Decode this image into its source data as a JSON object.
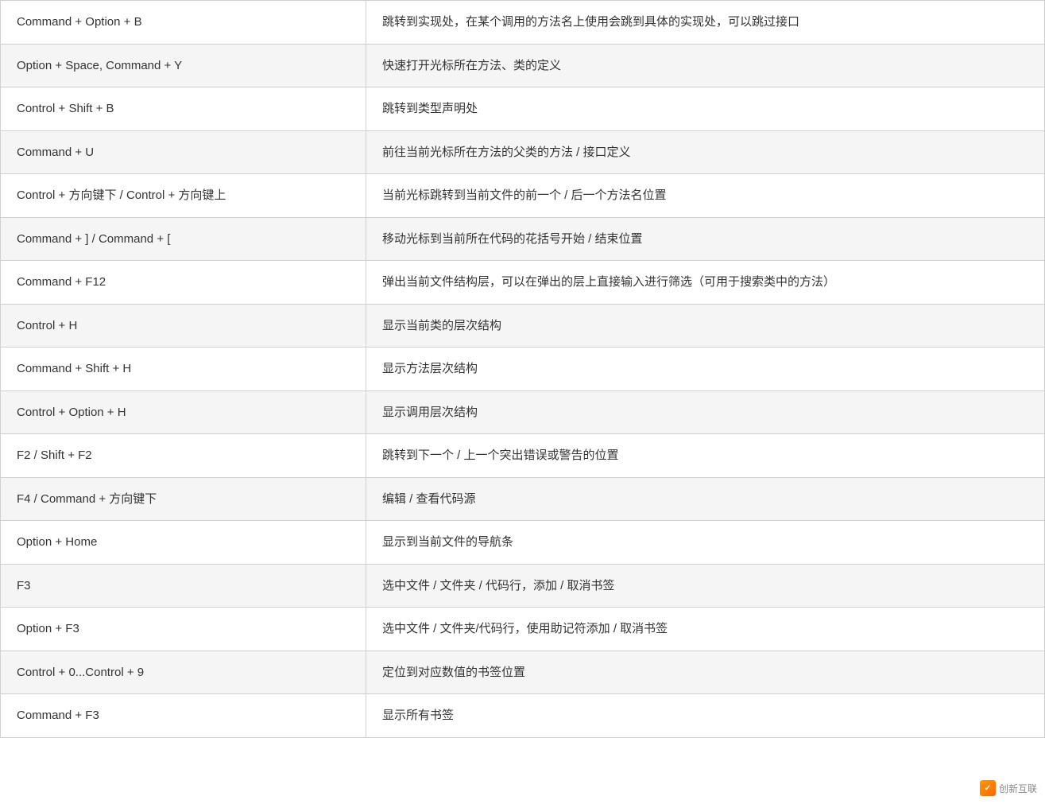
{
  "table": {
    "rows": [
      {
        "shortcut": "Command + Option + B",
        "description": "跳转到实现处，在某个调用的方法名上使用会跳到具体的实现处，可以跳过接口"
      },
      {
        "shortcut": "Option + Space, Command + Y",
        "description": "快速打开光标所在方法、类的定义"
      },
      {
        "shortcut": "Control + Shift + B",
        "description": "跳转到类型声明处"
      },
      {
        "shortcut": "Command + U",
        "description": "前往当前光标所在方法的父类的方法 / 接口定义"
      },
      {
        "shortcut": "Control + 方向键下 / Control + 方向键上",
        "description": "当前光标跳转到当前文件的前一个 / 后一个方法名位置"
      },
      {
        "shortcut": "Command + ] / Command + [",
        "description": "移动光标到当前所在代码的花括号开始 / 结束位置"
      },
      {
        "shortcut": "Command + F12",
        "description": "弹出当前文件结构层，可以在弹出的层上直接输入进行筛选（可用于搜索类中的方法）"
      },
      {
        "shortcut": "Control + H",
        "description": "显示当前类的层次结构"
      },
      {
        "shortcut": "Command + Shift + H",
        "description": "显示方法层次结构"
      },
      {
        "shortcut": "Control + Option + H",
        "description": "显示调用层次结构"
      },
      {
        "shortcut": "F2 / Shift + F2",
        "description": "跳转到下一个 / 上一个突出错误或警告的位置"
      },
      {
        "shortcut": "F4 / Command + 方向键下",
        "description": "编辑 / 查看代码源"
      },
      {
        "shortcut": "Option + Home",
        "description": "显示到当前文件的导航条"
      },
      {
        "shortcut": "F3",
        "description": "选中文件 / 文件夹 / 代码行，添加 / 取消书签"
      },
      {
        "shortcut": "Option + F3",
        "description": "选中文件 / 文件夹/代码行，使用助记符添加 / 取消书签"
      },
      {
        "shortcut": "Control + 0...Control + 9",
        "description": "定位到对应数值的书签位置"
      },
      {
        "shortcut": "Command + F3",
        "description": "显示所有书签"
      }
    ]
  },
  "watermark": {
    "text": "创新互联",
    "icon": "✓"
  }
}
